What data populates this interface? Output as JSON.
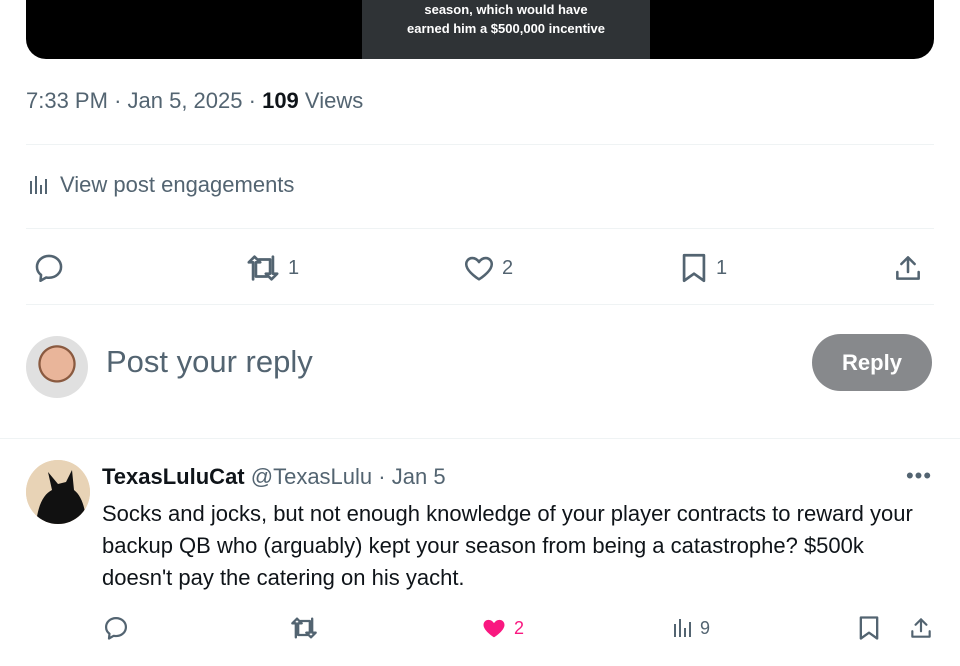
{
  "media": {
    "caption_lines": [
      "season, which would have",
      "earned him a $500,000 incentive"
    ]
  },
  "post_meta": {
    "time": "7:33 PM",
    "date": "Jan 5, 2025",
    "views_count": "109",
    "views_label": "Views"
  },
  "engagements": {
    "label": "View post engagements"
  },
  "actions": {
    "reposts": "1",
    "likes": "2",
    "bookmarks": "1"
  },
  "compose": {
    "placeholder": "Post your reply",
    "reply_button": "Reply"
  },
  "reply_tweet": {
    "name": "TexasLuluCat",
    "handle": "@TexasLulu",
    "date": "Jan 5",
    "text": "Socks and jocks, but not enough knowledge of your player contracts to reward your backup QB who (arguably) kept your season from being a catastrophe?  $500k doesn't pay the catering on his yacht.",
    "likes": "2",
    "views": "9",
    "like_color": "#f91880"
  }
}
